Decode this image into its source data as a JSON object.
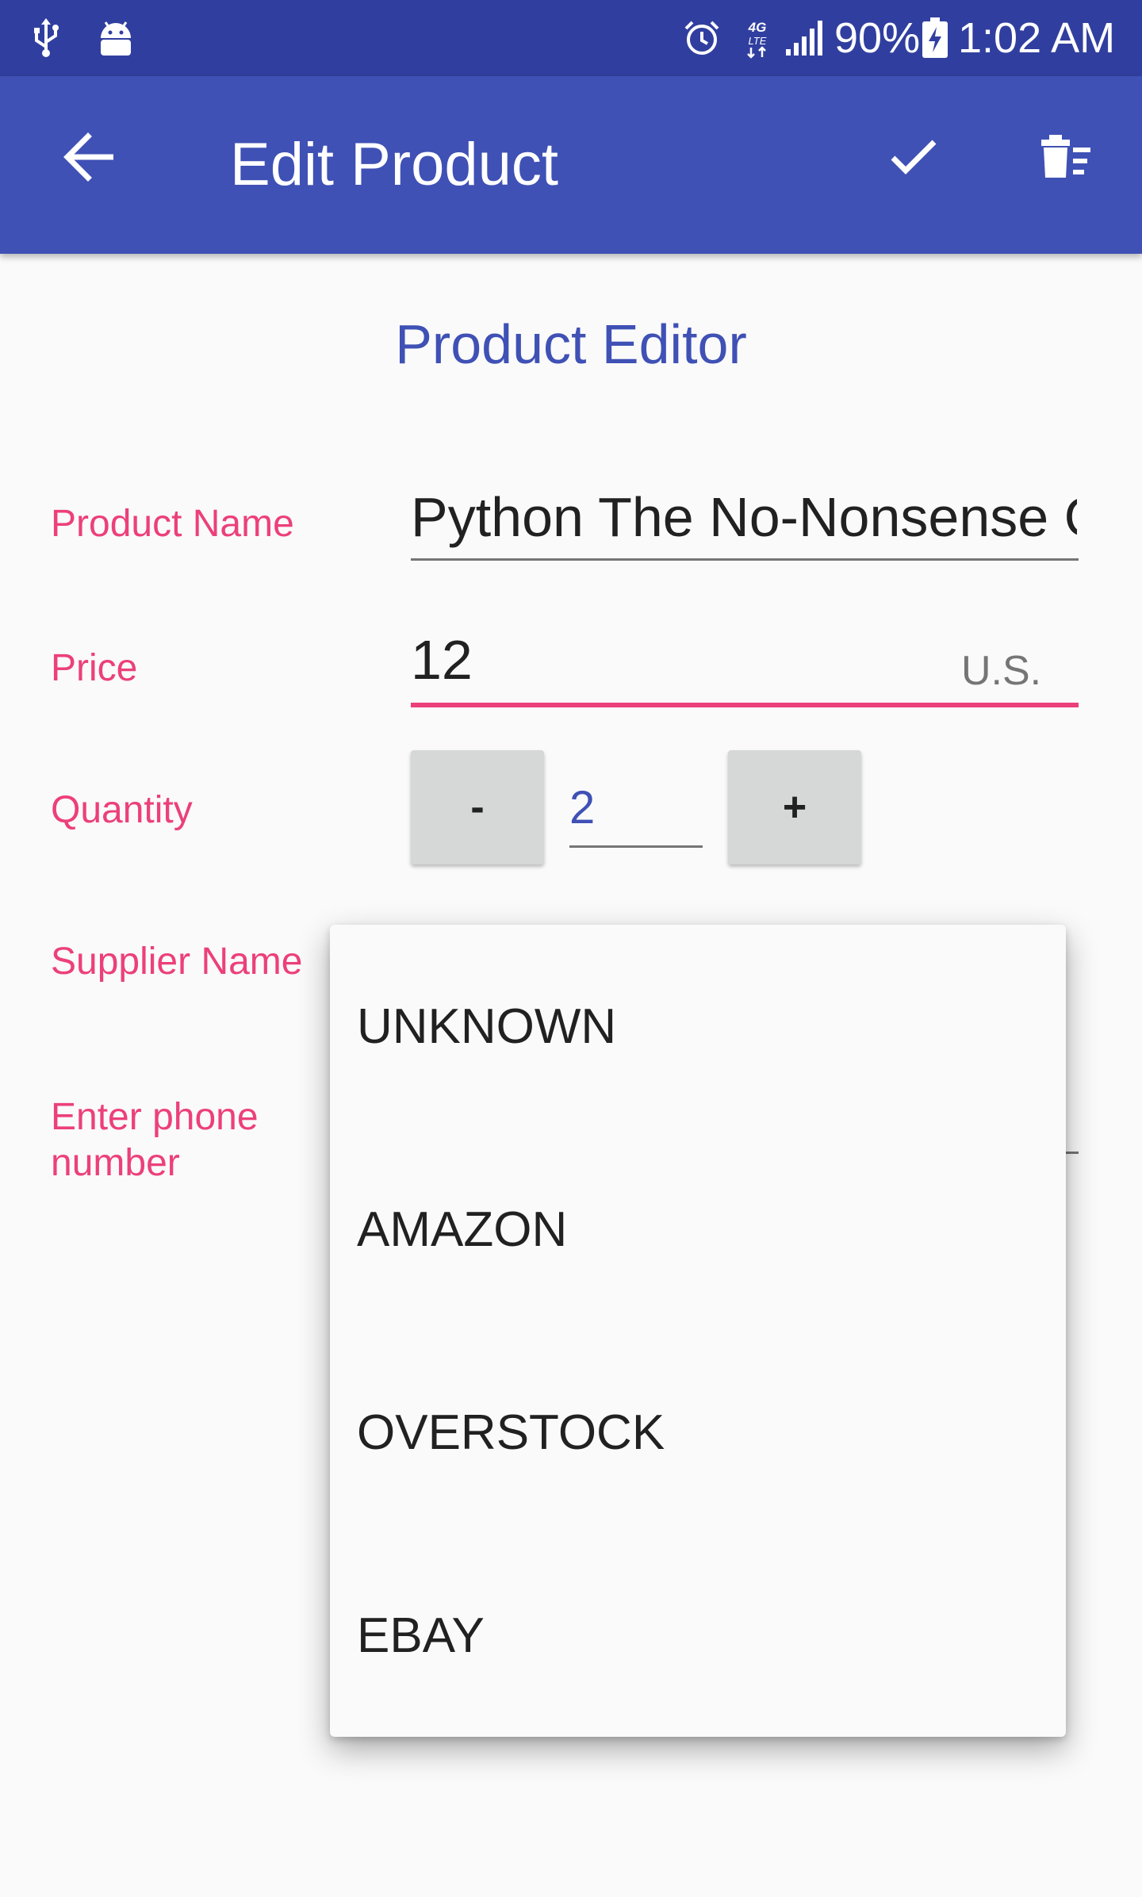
{
  "status_bar": {
    "network": "4G LTE",
    "battery": "90%",
    "time": "1:02 AM",
    "icons": [
      "usb-icon",
      "android-debug-icon",
      "alarm-icon",
      "lte-icon",
      "signal-icon",
      "battery-charging-icon"
    ]
  },
  "app_bar": {
    "title": "Edit Product",
    "icons": [
      "back-arrow-icon",
      "checkmark-icon",
      "delete-icon"
    ]
  },
  "form": {
    "section_title": "Product Editor",
    "product_name_label": "Product Name",
    "product_name_value": "Python The No-Nonsense Guide",
    "price_label": "Price",
    "price_value": "12",
    "price_suffix": "U.S.",
    "quantity_label": "Quantity",
    "quantity_minus": "-",
    "quantity_value": "2",
    "quantity_plus": "+",
    "supplier_label": "Supplier Name",
    "phone_label": "Enter phone number"
  },
  "supplier_dropdown": {
    "options": [
      "UNKNOWN",
      "AMAZON",
      "OVERSTOCK",
      "EBAY"
    ]
  },
  "colors": {
    "status_bar": "#303f9f",
    "app_bar": "#3f51b5",
    "accent": "#ec407a",
    "primary_text": "#3f51b5"
  }
}
